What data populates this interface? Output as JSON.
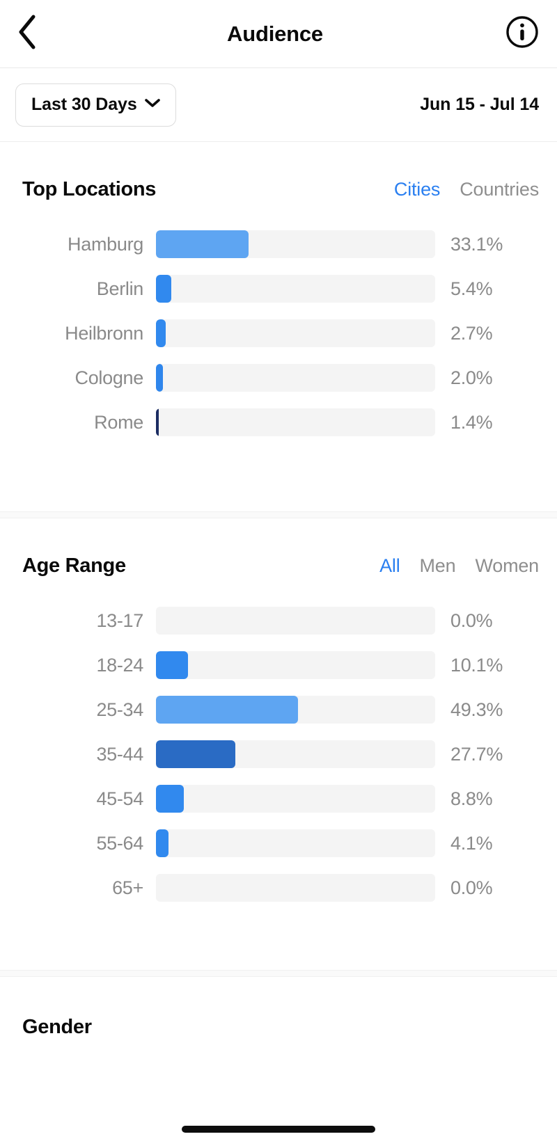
{
  "navbar": {
    "back_icon": "chevron-left-icon",
    "title": "Audience",
    "info_icon": "info-circle-icon"
  },
  "datebar": {
    "range_selector_label": "Last 30 Days",
    "chevron_icon": "chevron-down-icon",
    "date_range": "Jun 15 - Jul 14"
  },
  "colors": {
    "accent_blue": "#2a7ff0",
    "bar_track": "#f4f4f4",
    "text_primary": "#0a0a0a",
    "text_muted": "#8a8a8a",
    "toggle_inactive": "#8e8e8e"
  },
  "top_locations": {
    "title": "Top Locations",
    "toggles": [
      {
        "label": "Cities",
        "active": true
      },
      {
        "label": "Countries",
        "active": false
      }
    ]
  },
  "age_range": {
    "title": "Age Range",
    "toggles": [
      {
        "label": "All",
        "active": true
      },
      {
        "label": "Men",
        "active": false
      },
      {
        "label": "Women",
        "active": false
      }
    ]
  },
  "gender": {
    "title": "Gender"
  },
  "chart_data": [
    {
      "type": "bar",
      "title": "Top Locations",
      "orientation": "horizontal",
      "unit": "%",
      "xlabel": "",
      "ylabel": "",
      "xlim": [
        0,
        100
      ],
      "grid": false,
      "legend": "none",
      "selected_tab": "Cities",
      "categories": [
        "Hamburg",
        "Berlin",
        "Heilbronn",
        "Cologne",
        "Rome"
      ],
      "values": [
        33.1,
        5.4,
        2.7,
        2.0,
        1.4
      ],
      "value_labels": [
        "33.1%",
        "5.4%",
        "2.7%",
        "2.0%",
        "1.4%"
      ],
      "bar_colors": [
        "#5ea5f2",
        "#3189ee",
        "#3189ee",
        "#2f86ec",
        "#1c2d63"
      ],
      "bar_widths_pct": [
        33.1,
        5.4,
        3.4,
        2.6,
        1.1
      ]
    },
    {
      "type": "bar",
      "title": "Age Range",
      "orientation": "horizontal",
      "unit": "%",
      "xlabel": "",
      "ylabel": "",
      "xlim": [
        0,
        100
      ],
      "grid": false,
      "legend": "none",
      "selected_tab": "All",
      "categories": [
        "13-17",
        "18-24",
        "25-34",
        "35-44",
        "45-54",
        "55-64",
        "65+"
      ],
      "values": [
        0.0,
        10.1,
        49.3,
        27.7,
        8.8,
        4.1,
        0.0
      ],
      "value_labels": [
        "0.0%",
        "10.1%",
        "49.3%",
        "27.7%",
        "8.8%",
        "4.1%",
        "0.0%"
      ],
      "bar_colors": [
        "#f4f4f4",
        "#3189ee",
        "#5ea5f2",
        "#2a6bc4",
        "#3189ee",
        "#3189ee",
        "#f4f4f4"
      ],
      "bar_widths_pct": [
        0,
        11.5,
        50.8,
        28.5,
        10.0,
        4.5,
        0
      ]
    }
  ]
}
